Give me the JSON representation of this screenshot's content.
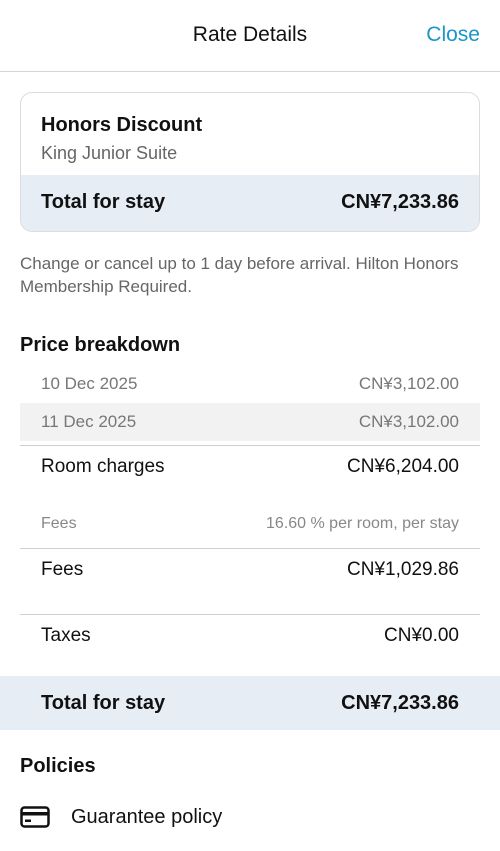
{
  "header": {
    "title": "Rate Details",
    "close_label": "Close"
  },
  "summary": {
    "rate_name": "Honors Discount",
    "room_name": "King Junior Suite",
    "total_label": "Total for stay",
    "total_value": "CN¥7,233.86"
  },
  "cancellation_note": "Change or cancel up to 1 day before arrival. Hilton Honors Membership Required.",
  "breakdown": {
    "title": "Price breakdown",
    "nightly": [
      {
        "date": "10 Dec 2025",
        "price": "CN¥3,102.00"
      },
      {
        "date": "11 Dec 2025",
        "price": "CN¥3,102.00"
      }
    ],
    "room_charges": {
      "label": "Room charges",
      "value": "CN¥6,204.00"
    },
    "fees_detail": {
      "label": "Fees",
      "value": "16.60 % per room, per stay"
    },
    "fees": {
      "label": "Fees",
      "value": "CN¥1,029.86"
    },
    "taxes": {
      "label": "Taxes",
      "value": "CN¥0.00"
    },
    "total": {
      "label": "Total for stay",
      "value": "CN¥7,233.86"
    }
  },
  "policies": {
    "title": "Policies",
    "items": [
      {
        "label": "Guarantee policy",
        "icon": "credit-card-icon"
      }
    ]
  },
  "colors": {
    "accent": "#1a96c9",
    "total_bar": "#e7edf4",
    "shaded_row": "#f2f2f2"
  }
}
